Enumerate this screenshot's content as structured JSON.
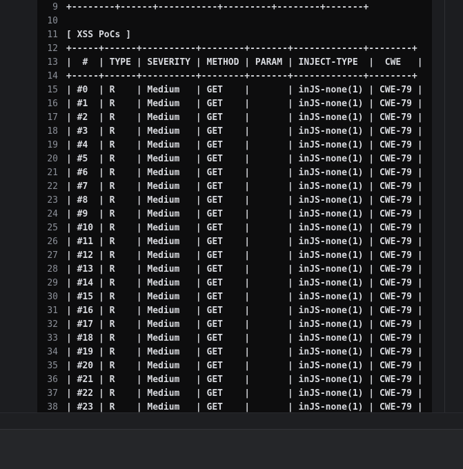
{
  "editor": {
    "lines": [
      {
        "n": "9",
        "text": "+--------+------+-----------+---------+--------+-------+"
      },
      {
        "n": "10",
        "text": ""
      },
      {
        "n": "11",
        "text": "[ XSS PoCs ]"
      },
      {
        "n": "12",
        "text": "+-----+------+----------+--------+-------+-------------+--------+"
      },
      {
        "n": "13",
        "text": "|  #  | TYPE | SEVERITY | METHOD | PARAM | INJECT-TYPE  |  CWE   |"
      },
      {
        "n": "14",
        "text": "+-----+------+----------+--------+-------+-------------+--------+"
      },
      {
        "n": "15",
        "text": "| #0  | R    | Medium   | GET    |       | inJS-none(1) | CWE-79 |"
      },
      {
        "n": "16",
        "text": "| #1  | R    | Medium   | GET    |       | inJS-none(1) | CWE-79 |"
      },
      {
        "n": "17",
        "text": "| #2  | R    | Medium   | GET    |       | inJS-none(1) | CWE-79 |"
      },
      {
        "n": "18",
        "text": "| #3  | R    | Medium   | GET    |       | inJS-none(1) | CWE-79 |"
      },
      {
        "n": "19",
        "text": "| #4  | R    | Medium   | GET    |       | inJS-none(1) | CWE-79 |"
      },
      {
        "n": "20",
        "text": "| #5  | R    | Medium   | GET    |       | inJS-none(1) | CWE-79 |"
      },
      {
        "n": "21",
        "text": "| #6  | R    | Medium   | GET    |       | inJS-none(1) | CWE-79 |"
      },
      {
        "n": "22",
        "text": "| #7  | R    | Medium   | GET    |       | inJS-none(1) | CWE-79 |"
      },
      {
        "n": "23",
        "text": "| #8  | R    | Medium   | GET    |       | inJS-none(1) | CWE-79 |"
      },
      {
        "n": "24",
        "text": "| #9  | R    | Medium   | GET    |       | inJS-none(1) | CWE-79 |"
      },
      {
        "n": "25",
        "text": "| #10 | R    | Medium   | GET    |       | inJS-none(1) | CWE-79 |"
      },
      {
        "n": "26",
        "text": "| #11 | R    | Medium   | GET    |       | inJS-none(1) | CWE-79 |"
      },
      {
        "n": "27",
        "text": "| #12 | R    | Medium   | GET    |       | inJS-none(1) | CWE-79 |"
      },
      {
        "n": "28",
        "text": "| #13 | R    | Medium   | GET    |       | inJS-none(1) | CWE-79 |"
      },
      {
        "n": "29",
        "text": "| #14 | R    | Medium   | GET    |       | inJS-none(1) | CWE-79 |"
      },
      {
        "n": "30",
        "text": "| #15 | R    | Medium   | GET    |       | inJS-none(1) | CWE-79 |"
      },
      {
        "n": "31",
        "text": "| #16 | R    | Medium   | GET    |       | inJS-none(1) | CWE-79 |"
      },
      {
        "n": "32",
        "text": "| #17 | R    | Medium   | GET    |       | inJS-none(1) | CWE-79 |"
      },
      {
        "n": "33",
        "text": "| #18 | R    | Medium   | GET    |       | inJS-none(1) | CWE-79 |"
      },
      {
        "n": "34",
        "text": "| #19 | R    | Medium   | GET    |       | inJS-none(1) | CWE-79 |"
      },
      {
        "n": "35",
        "text": "| #20 | R    | Medium   | GET    |       | inJS-none(1) | CWE-79 |"
      },
      {
        "n": "36",
        "text": "| #21 | R    | Medium   | GET    |       | inJS-none(1) | CWE-79 |"
      },
      {
        "n": "37",
        "text": "| #22 | R    | Medium   | GET    |       | inJS-none(1) | CWE-79 |"
      },
      {
        "n": "38",
        "text": "| #23 | R    | Medium   | GET    |       | inJS-none(1) | CWE-79 |"
      }
    ]
  }
}
